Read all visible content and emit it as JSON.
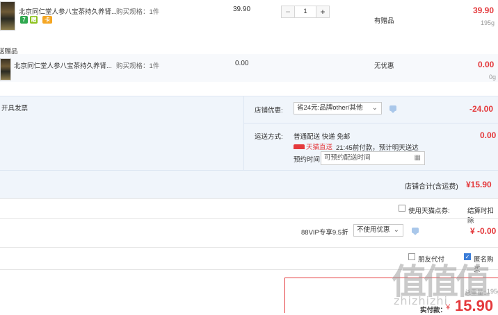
{
  "items": [
    {
      "title": "北京同仁堂人参八宝茶持久养肾...",
      "spec": "购买规格：1件",
      "unit_price": "39.90",
      "quantity": "1",
      "gift_status": "有赠品",
      "subtotal": "39.90",
      "weight": "195g",
      "tags": [
        {
          "text": "7",
          "color": "#2fa84f"
        },
        {
          "text": "赠",
          "color": "#8dc21f"
        },
        {
          "text": "卡",
          "color": "#f5a623"
        }
      ]
    }
  ],
  "gift_section_label": "送赠品",
  "gift_item": {
    "title": "北京同仁堂人参八宝茶持久养肾...",
    "spec": "购买规格：1件",
    "unit_price": "0.00",
    "promo": "无优惠",
    "subtotal": "0.00",
    "weight": "0g"
  },
  "store": {
    "invoice_label": "开具发票",
    "discount_label": "店铺优惠:",
    "discount_select": "省24元:品牌other/其他",
    "discount_amount": "-24.00",
    "shipping_label": "运送方式:",
    "shipping_method": "普通配送 快递 免邮",
    "shipping_fee": "0.00",
    "tmall_badge": "天猫直送",
    "delivery_note": "21:45前付款，预计明天送达",
    "appointment_label": "预约时间",
    "appointment_placeholder": "可预约配送时间",
    "store_total_label": "店铺合计(含运费)",
    "store_total": "¥15.90"
  },
  "points": {
    "label": "使用天猫点券:",
    "right_text": "结算时扣除"
  },
  "vip": {
    "label": "88VIP专享9.5折",
    "select": "不使用优惠",
    "amount": "¥ -0.00"
  },
  "options": {
    "friend_pay": "朋友代付",
    "anonymous": "匿名购买"
  },
  "summary": {
    "total_weight_label": "总重量：",
    "total_weight": "195g",
    "pay_label": "实付款：",
    "currency": "¥",
    "pay_amount": "15.90"
  },
  "watermark": {
    "big": "值值值",
    "small": "zhizhizhi"
  }
}
